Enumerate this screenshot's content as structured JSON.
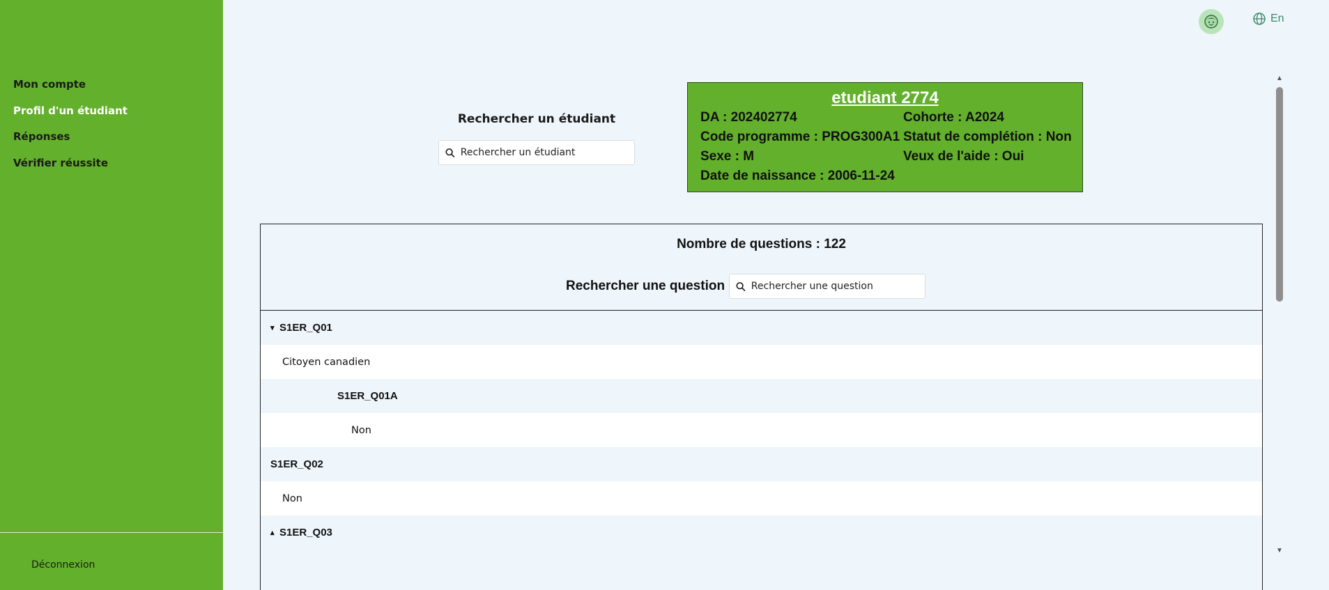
{
  "sidebar": {
    "items": [
      {
        "label": "Mon compte"
      },
      {
        "label": "Profil d'un étudiant"
      },
      {
        "label": "Réponses"
      },
      {
        "label": "Vérifier réussite"
      }
    ],
    "active_index": 1,
    "logout_label": "Déconnexion"
  },
  "header": {
    "avatar_icon": "student-avatar-icon",
    "language_icon": "globe-icon",
    "language_label": "En"
  },
  "student_search": {
    "title": "Rechercher un étudiant",
    "placeholder": "Rechercher un étudiant",
    "value": ""
  },
  "student": {
    "name": "etudiant 2774",
    "da": "DA : 202402774",
    "cohorte": "Cohorte : A2024",
    "programme": "Code programme : PROG300A1",
    "statut": "Statut de complétion : Non",
    "sexe": "Sexe : M",
    "aide": "Veux de l'aide : Oui",
    "naissance": "Date de naissance : 2006-11-24"
  },
  "questions": {
    "count_label": "Nombre de questions : 122",
    "search_label": "Rechercher une question",
    "search_placeholder": "Rechercher une question",
    "rows": [
      {
        "type": "question",
        "code": "S1ER_Q01",
        "caret": "▾"
      },
      {
        "type": "answer",
        "text": "Citoyen canadien"
      },
      {
        "type": "question",
        "code": "S1ER_Q01A"
      },
      {
        "type": "answer",
        "text": "Non"
      },
      {
        "type": "question",
        "code": "S1ER_Q02"
      },
      {
        "type": "answer",
        "text": "Non"
      },
      {
        "type": "question",
        "code": "S1ER_Q03",
        "caret": "▴"
      }
    ]
  },
  "colors": {
    "sidebar": "#63b02c",
    "background": "#eef5fb",
    "card": "#63b02c",
    "avatar": "#b9e4b9",
    "language": "#3c8a6a"
  }
}
